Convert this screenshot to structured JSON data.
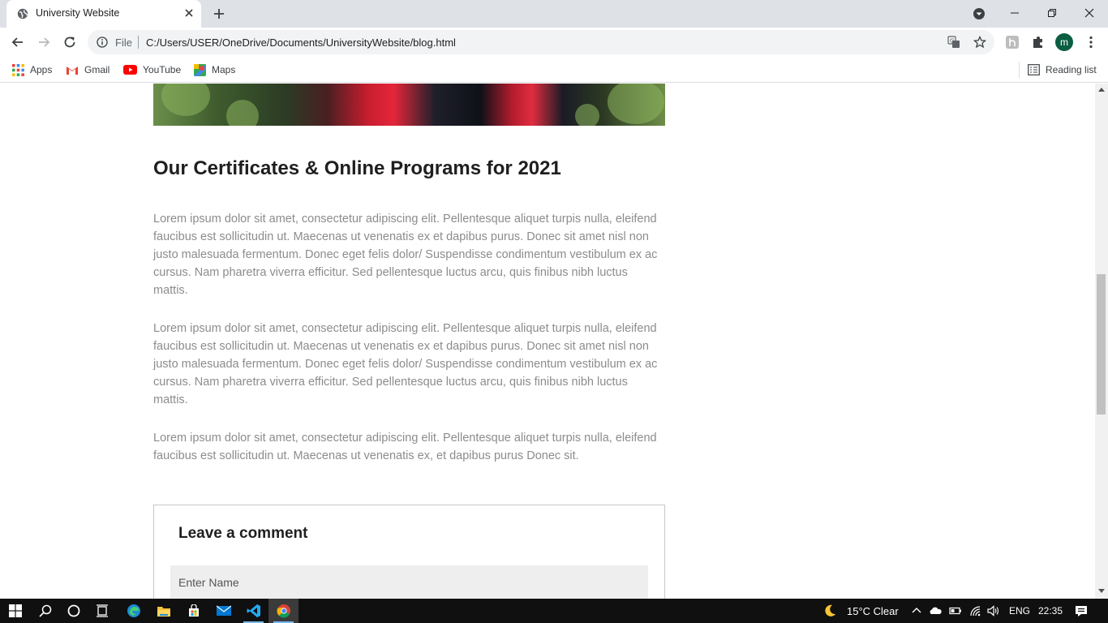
{
  "tab": {
    "title": "University Website"
  },
  "omnibox": {
    "scheme_label": "File",
    "url": "C:/Users/USER/OneDrive/Documents/UniversityWebsite/blog.html"
  },
  "profile": {
    "initial": "m",
    "color": "#0b5e41"
  },
  "bookmarks": {
    "items": [
      {
        "label": "Apps",
        "icon": "apps-grid-icon"
      },
      {
        "label": "Gmail",
        "icon": "gmail-icon"
      },
      {
        "label": "YouTube",
        "icon": "youtube-icon"
      },
      {
        "label": "Maps",
        "icon": "maps-icon"
      }
    ],
    "reading_list": "Reading list"
  },
  "article": {
    "title": "Our Certificates & Online Programs for 2021",
    "paragraphs": [
      "Lorem ipsum dolor sit amet, consectetur adipiscing elit. Pellentesque aliquet turpis nulla, eleifend faucibus est sollicitudin ut. Maecenas ut venenatis ex et dapibus purus. Donec sit amet nisl non justo malesuada fermentum. Donec eget felis dolor/ Suspendisse condimentum vestibulum ex ac cursus. Nam pharetra viverra efficitur. Sed pellentesque luctus arcu, quis finibus nibh luctus mattis.",
      "Lorem ipsum dolor sit amet, consectetur adipiscing elit. Pellentesque aliquet turpis nulla, eleifend faucibus est sollicitudin ut. Maecenas ut venenatis ex et dapibus purus. Donec sit amet nisl non justo malesuada fermentum. Donec eget felis dolor/ Suspendisse condimentum vestibulum ex ac cursus. Nam pharetra viverra efficitur. Sed pellentesque luctus arcu, quis finibus nibh luctus mattis.",
      "Lorem ipsum dolor sit amet, consectetur adipiscing elit. Pellentesque aliquet turpis nulla, eleifend faucibus est sollicitudin ut. Maecenas ut venenatis ex, et dapibus purus Donec sit."
    ]
  },
  "comment": {
    "heading": "Leave a comment",
    "name_placeholder": "Enter Name"
  },
  "taskbar": {
    "weather": "15°C  Clear",
    "language": "ENG",
    "time": "22:35"
  }
}
